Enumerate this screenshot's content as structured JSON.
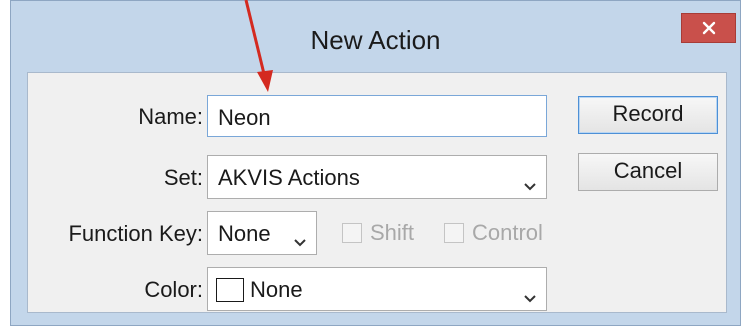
{
  "dialog": {
    "title": "New Action",
    "close_label": "✕"
  },
  "form": {
    "name_label": "Name:",
    "name_value": "Neon",
    "set_label": "Set:",
    "set_value": "AKVIS Actions",
    "function_key_label": "Function Key:",
    "function_key_value": "None",
    "shift_label": "Shift",
    "shift_checked": false,
    "control_label": "Control",
    "control_checked": false,
    "color_label": "Color:",
    "color_value": "None"
  },
  "buttons": {
    "record_label": "Record",
    "cancel_label": "Cancel"
  },
  "icons": {
    "close": "close-icon",
    "dropdown": "chevron-down-icon",
    "annotation": "red-arrow-icon"
  },
  "colors": {
    "title_bar": "#c3d6ea",
    "close_button": "#c9504b",
    "annotation_arrow": "#d42a20",
    "focus_border": "#4d90d6"
  }
}
